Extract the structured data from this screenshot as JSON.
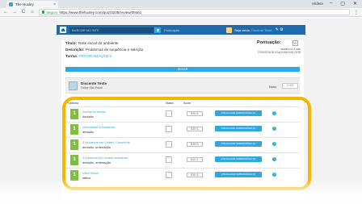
{
  "browser": {
    "tab_title": "The Huxley",
    "tab_close": "×",
    "user_label": "Hildete",
    "win_controls": [
      "–",
      "▢",
      "✕"
    ],
    "nav": [
      "←",
      "→",
      "C",
      "⌂"
    ],
    "secure_label": "Seguro",
    "url": "https://www.thehuxley.com/quiz/3235/review/39461",
    "menu": "⋮"
  },
  "topnav": {
    "search_placeholder": "BUSCAR NO SITE",
    "pontuacao": "Pontuação",
    "welcome_prefix": "Seja vindo,",
    "welcome_user": "Docente Teste",
    "icons": "✎ ⚙"
  },
  "quiz": {
    "titulo_label": "Título:",
    "titulo_value": "Teste inicial do ambiente",
    "descricao_label": "Descrição:",
    "descricao_value": "Problemas de sequência e seleção",
    "turma_label": "Turma:",
    "turma_value": "PROGRAMAÇÃO 2",
    "pontuacao_label": "Pontuação:",
    "pontuacao_value": "0",
    "dates_line1": "Iniciará em 4 dias",
    "dates_line2": "27/09/2016 00:00 à 01/09/2016 23:59",
    "edit_label": "EDITAR"
  },
  "student": {
    "name": "Discente Teste",
    "class": "Felipe São Paulo",
    "nota_label": "Nota:",
    "nota_placeholder": "0.000"
  },
  "table": {
    "headers": {
      "problema": "Problema",
      "status": "Status",
      "score": "Score"
    },
    "rows": [
      {
        "num": "1",
        "title": "Acima da média",
        "sub": "decisão",
        "score": "0.0 / 1",
        "button": "VISUALIZAR SUBMISSÕES (0)",
        "help": "?"
      },
      {
        "num": "1",
        "title": "Velocidade e Distância",
        "sub": "decisão",
        "score": "0.0 / 1",
        "button": "VISUALIZAR SUBMISSÕES (0)",
        "help": "?"
      },
      {
        "num": "1",
        "title": "3 Números em Ordem Crescente",
        "sub": "decisão, ordenação",
        "score": "0.0 / 1",
        "button": "VISUALIZAR SUBMISSÕES (0)",
        "help": "?"
      },
      {
        "num": "1",
        "title": "3 números em ordem crescente",
        "sub": "decisão, ordenação",
        "score": "0.0 / 1",
        "button": "VISUALIZAR SUBMISSÕES (0)",
        "help": "?"
      },
      {
        "num": "1",
        "title": "Valor Maior",
        "sub": "lattice",
        "score": "0.0 / 1",
        "button": "VISUALIZAR SUBMISSÕES (0)",
        "help": "?"
      }
    ]
  },
  "colors": {
    "brand_blue": "#1f6bab",
    "accent_blue": "#2ea8df",
    "difficulty_green": "#7fbf3f",
    "highlight_yellow": "#f7b500"
  }
}
